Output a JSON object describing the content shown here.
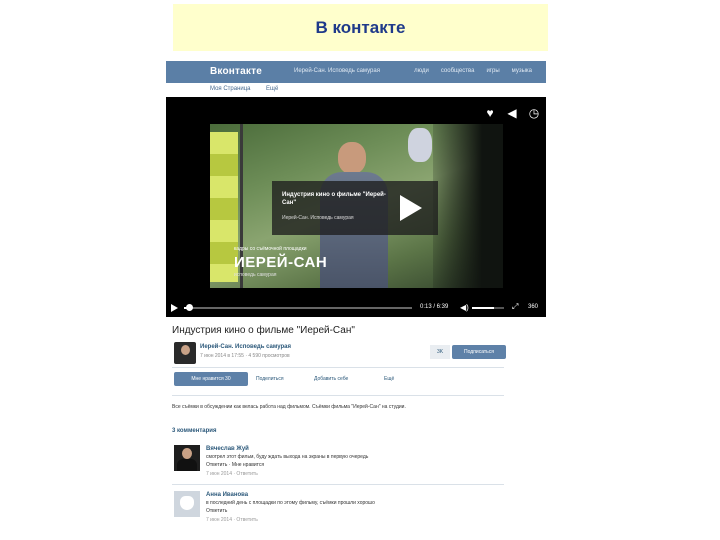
{
  "slide": {
    "title": "В контакте"
  },
  "vk": {
    "logo": "Вконтакте",
    "search": "Иерей-Сан. Исповедь самурая",
    "top_menu": [
      "люди",
      "сообщества",
      "игры",
      "музыка"
    ],
    "subnav": [
      "Моя Страница",
      "Ещё"
    ]
  },
  "player": {
    "card_title": "Индустрия кино о фильме \"Иерей-Сан\"",
    "card_sub": "Иерей-Сан. Исповедь самурая",
    "ad_label": "кадры со съёмочной площадки",
    "ad_big": "ИЕРЕЙ-САН",
    "ad_small": "исповедь самурая",
    "time": "0:13 / 6:39",
    "quality": "360",
    "progress_fraction": 0.02,
    "volume_fraction": 0.7
  },
  "video": {
    "title": "Индустрия кино о фильме \"Иерей-Сан\"",
    "author": "Иерей-Сан. Исповедь самурая",
    "author_meta": "7 июн 2014 в 17:55 · 4 590 просмотров",
    "sub_count": "3K",
    "subscribe": "Подписаться",
    "like": "Мне нравится  30",
    "share": "Поделиться",
    "add": "Добавить себе",
    "more": "Ещё"
  },
  "description": "Все съёмки в обсуждении как велась работа над фильмом. Съёмки фильма \"Иерей-Сан\" на студии.",
  "comments_count": "3 комментария",
  "comments": [
    {
      "name": "Вячеслав Жуй",
      "text": "смотрел этот фильм, буду ждать выхода на экраны в первую очередь",
      "sub": "Ответить · Мне нравится",
      "meta": "7 июн 2014 · Ответить",
      "avatar": "person-suit"
    },
    {
      "name": "Анна Иванова",
      "text": "в последний день с площадки по этому фильму, съёмки прошли хорошо",
      "sub": "Ответить",
      "meta": "7 июн 2014 · Ответить",
      "avatar": "paw"
    }
  ],
  "colors": {
    "vk_blue": "#5b7fa6",
    "link": "#2b587a",
    "title_bg": "#ffffcc",
    "title_text": "#1f3a8a"
  },
  "icons": [
    "heart-icon",
    "share-icon",
    "time-icon",
    "play-icon",
    "volume-icon",
    "fullscreen-icon"
  ]
}
